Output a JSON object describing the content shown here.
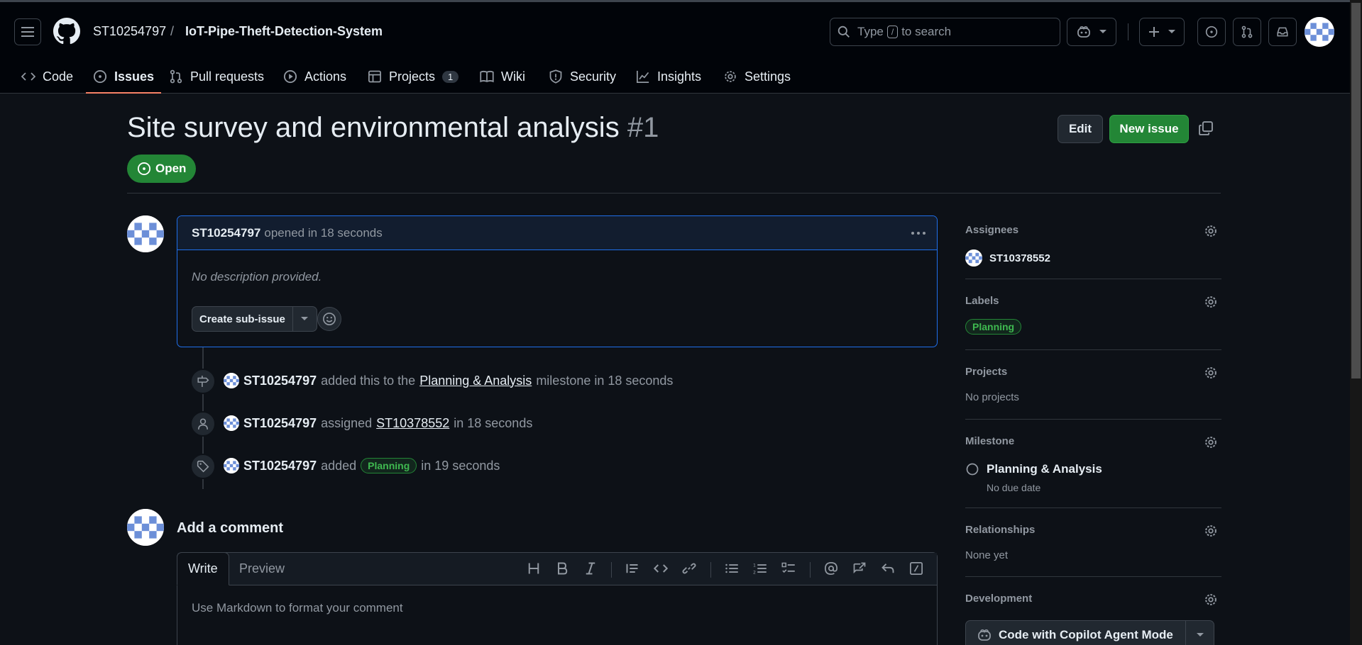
{
  "header": {
    "owner": "ST10254797",
    "separator": "/",
    "repo": "IoT-Pipe-Theft-Detection-System",
    "search_prefix": "Type",
    "search_key": "/",
    "search_suffix": "to search"
  },
  "repo_nav": {
    "code": "Code",
    "issues": "Issues",
    "pull_requests": "Pull requests",
    "actions": "Actions",
    "projects": "Projects",
    "projects_count": "1",
    "wiki": "Wiki",
    "security": "Security",
    "insights": "Insights",
    "settings": "Settings"
  },
  "issue": {
    "title": "Site survey and environmental analysis",
    "number": "#1",
    "state": "Open",
    "edit_label": "Edit",
    "new_issue_label": "New issue",
    "author": "ST10254797",
    "opened_text": "opened in 18 seconds",
    "body": "No description provided.",
    "create_sub_issue": "Create sub-issue"
  },
  "timeline": [
    {
      "actor": "ST10254797",
      "pre": "added this to the",
      "link": "Planning & Analysis",
      "post": "milestone in 18 seconds"
    },
    {
      "actor": "ST10254797",
      "pre": "assigned",
      "link": "ST10378552",
      "post": "in 18 seconds"
    },
    {
      "actor": "ST10254797",
      "pre": "added",
      "label": "Planning",
      "post": "in 19 seconds"
    }
  ],
  "comment": {
    "title": "Add a comment",
    "tab_write": "Write",
    "tab_preview": "Preview",
    "placeholder": "Use Markdown to format your comment"
  },
  "sidebar": {
    "assignees_title": "Assignees",
    "assignee": "ST10378552",
    "labels_title": "Labels",
    "label": "Planning",
    "projects_title": "Projects",
    "projects_value": "No projects",
    "milestone_title": "Milestone",
    "milestone_name": "Planning & Analysis",
    "milestone_due": "No due date",
    "relationships_title": "Relationships",
    "relationships_value": "None yet",
    "development_title": "Development",
    "copilot_button": "Code with Copilot Agent Mode"
  },
  "colors": {
    "accent_green": "#238636",
    "accent_blue": "#1f6feb",
    "tab_underline": "#f78166",
    "background": "#0d1117"
  }
}
